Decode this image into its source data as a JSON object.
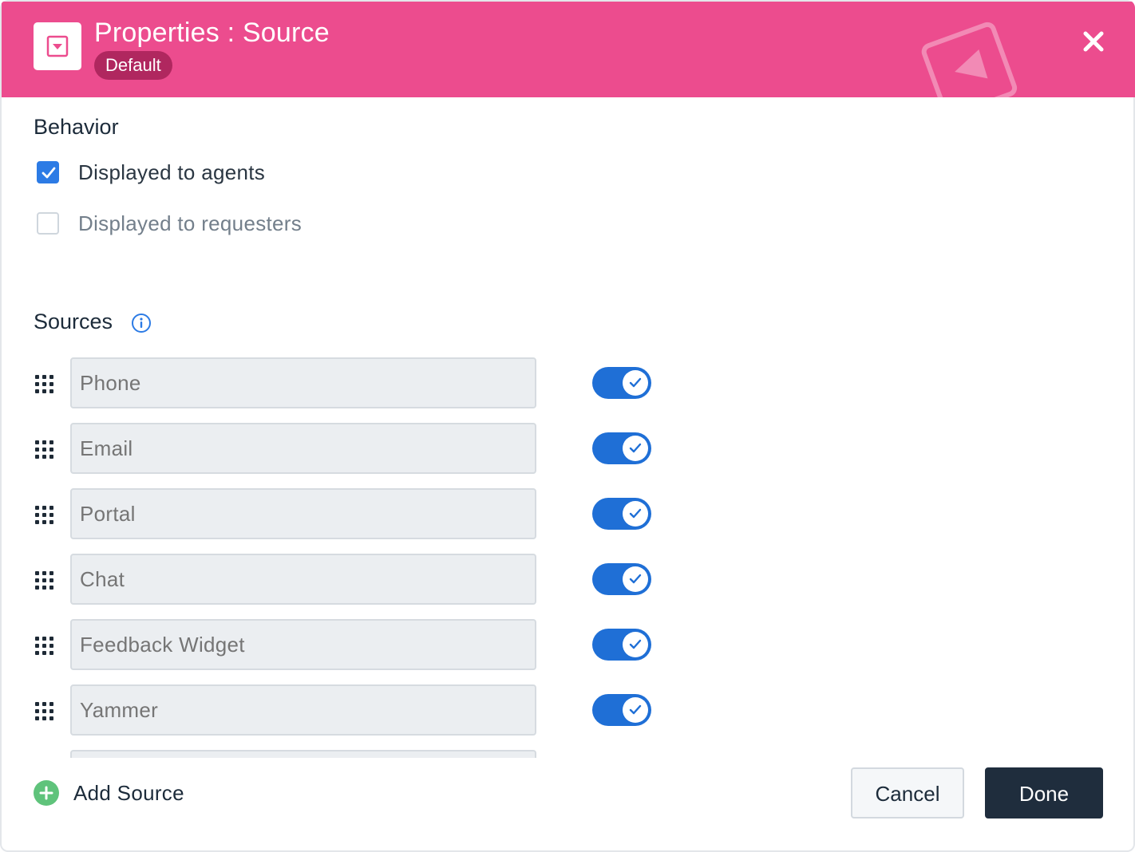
{
  "header": {
    "title": "Properties : Source",
    "badge": "Default",
    "icon": "dropdown-field-icon",
    "close_icon": "close-icon",
    "color": "#ec4c8e"
  },
  "behavior": {
    "title": "Behavior",
    "options": [
      {
        "label": "Displayed to agents",
        "checked": true
      },
      {
        "label": "Displayed to requesters",
        "checked": false
      }
    ]
  },
  "sources": {
    "title": "Sources",
    "info_icon": "info-icon",
    "items": [
      {
        "placeholder": "Phone",
        "enabled": true
      },
      {
        "placeholder": "Email",
        "enabled": true
      },
      {
        "placeholder": "Portal",
        "enabled": true
      },
      {
        "placeholder": "Chat",
        "enabled": true
      },
      {
        "placeholder": "Feedback Widget",
        "enabled": true
      },
      {
        "placeholder": "Yammer",
        "enabled": true
      }
    ]
  },
  "footer": {
    "add_source_label": "Add Source",
    "cancel_label": "Cancel",
    "done_label": "Done"
  },
  "colors": {
    "accent_blue": "#1f6fd6",
    "checkbox_blue": "#2c7be5",
    "add_green": "#5fc37b",
    "done_dark": "#1f2d3d"
  }
}
